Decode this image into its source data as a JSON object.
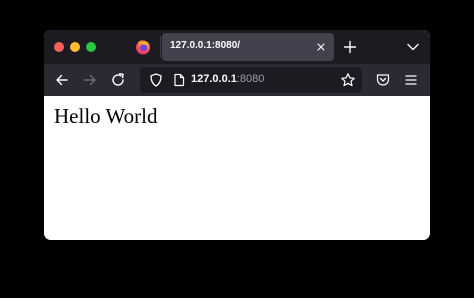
{
  "window": {
    "controls": [
      "close",
      "minimize",
      "maximize"
    ]
  },
  "tabs": [
    {
      "title": "127.0.0.1:8080/",
      "active": true
    }
  ],
  "urlbar": {
    "host": "127.0.0.1",
    "port": ":8080"
  },
  "page": {
    "heading": "Hello World"
  },
  "icons": {
    "browser_logo": "firefox-logo-icon",
    "tab_close": "close-icon",
    "new_tab": "plus-icon",
    "tab_list": "chevron-down-icon",
    "back": "back-arrow-icon",
    "forward": "forward-arrow-icon",
    "reload": "reload-icon",
    "tracking_protection": "shield-icon",
    "site_info": "page-icon",
    "bookmark": "star-icon",
    "pocket": "pocket-icon",
    "menu": "hamburger-menu-icon"
  },
  "colors": {
    "tabbar_bg": "#1c1b22",
    "toolbar_bg": "#2b2a33",
    "active_tab_bg": "#42414d",
    "close_dot": "#fe5f57",
    "minimize_dot": "#febc2e",
    "maximize_dot": "#28c840"
  }
}
